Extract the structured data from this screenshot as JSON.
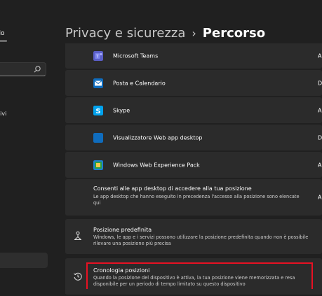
{
  "sidebar": {
    "profile_name": "llo",
    "partial_item": "tivi"
  },
  "header": {
    "parent": "Privacy e sicurezza",
    "separator": "›",
    "current": "Percorso"
  },
  "apps": [
    {
      "name": "Microsoft Teams",
      "state": "A",
      "icon": "teams-icon",
      "color": "#5b5fc7"
    },
    {
      "name": "Posta e Calendario",
      "state": "D",
      "icon": "mail-icon",
      "color": "#0f6cbd"
    },
    {
      "name": "Skype",
      "state": "A",
      "icon": "skype-icon",
      "color": "#00a2ed"
    },
    {
      "name": "Visualizzatore Web app desktop",
      "state": "D",
      "icon": "web-app-icon",
      "color": "#0f6cbd"
    },
    {
      "name": "Windows Web Experience Pack",
      "state": "A",
      "icon": "web-experience-icon",
      "color": "#1c7fd1"
    }
  ],
  "desktop_apps": {
    "title": "Consenti alle app desktop di accedere alla tua posizione",
    "description": "Le app desktop che hanno eseguito in precedenza l'accesso alla posizione sono elencate qui",
    "state": "A"
  },
  "default_location": {
    "title": "Posizione predefinita",
    "description": "Windows, le app e i servizi possono utilizzare la posizione predefinita quando non è possibile rilevare una posizione più precisa"
  },
  "location_history": {
    "title": "Cronologia posizioni",
    "description": "Quando la posizione del dispositivo è attiva, la tua posizione viene memorizzata e resa disponibile per un periodo di tempo limitato su questo dispositivo"
  },
  "colors": {
    "background": "#202020",
    "card": "#2b2b2b",
    "highlight": "#e81123"
  }
}
